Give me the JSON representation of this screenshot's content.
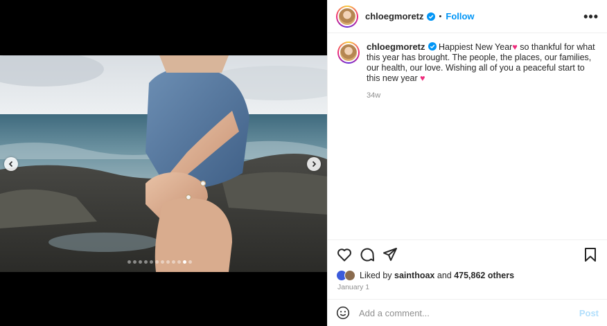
{
  "post": {
    "username": "chloegmoretz",
    "separator": "•",
    "follow_label": "Follow",
    "more_label": "•••",
    "caption": {
      "username": "chloegmoretz",
      "text_1": "Happiest New Year",
      "emoji_1": "♥",
      "text_2": " so thankful for what this year has brought. The people, the places, our families, our health, our love. Wishing all of you a peaceful start to this new year ",
      "emoji_2": "♥"
    },
    "time_ago": "34w",
    "likes": {
      "prefix": "Liked by ",
      "user": "sainthoax",
      "middle": " and ",
      "count": "475,862 others"
    },
    "date": "January 1",
    "comment_placeholder": "Add a comment...",
    "post_label": "Post"
  },
  "carousel": {
    "total_slides": 12,
    "active_index": 10
  },
  "colors": {
    "accent": "#0095f6",
    "verified": "#0095f6",
    "heart": "#ee2a7b",
    "post_disabled": "#b2dffc"
  },
  "icons": {
    "prev": "chevron-left-icon",
    "next": "chevron-right-icon",
    "like": "heart-icon",
    "comment": "comment-icon",
    "share": "share-icon",
    "save": "bookmark-icon",
    "emoji": "emoji-icon",
    "verified": "verified-badge-icon",
    "more": "more-options-icon"
  }
}
